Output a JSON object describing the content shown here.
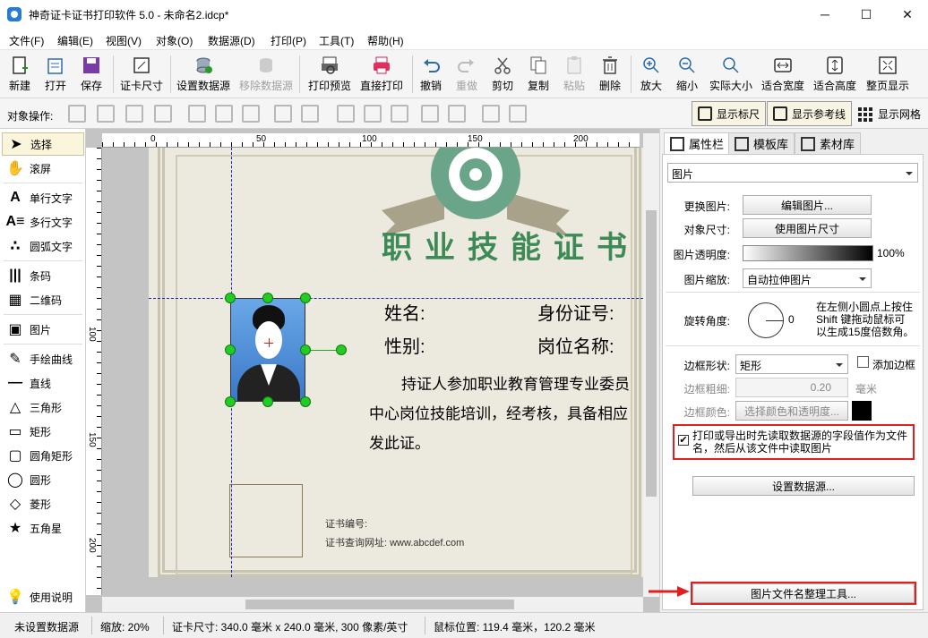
{
  "window": {
    "title": "神奇证卡证书打印软件 5.0 - 未命名2.idcp*"
  },
  "menu": [
    "文件(F)",
    "编辑(E)",
    "视图(V)",
    "对象(O)",
    "数据源(D)",
    "打印(P)",
    "工具(T)",
    "帮助(H)"
  ],
  "toolbar": [
    {
      "label": "新建",
      "icon": "new-file-icon"
    },
    {
      "label": "打开",
      "icon": "open-icon"
    },
    {
      "label": "保存",
      "icon": "save-icon"
    },
    {
      "label": "证卡尺寸",
      "icon": "card-size-icon"
    },
    {
      "label": "设置数据源",
      "icon": "database-icon"
    },
    {
      "label": "移除数据源",
      "icon": "remove-database-icon"
    },
    {
      "label": "打印预览",
      "icon": "print-preview-icon"
    },
    {
      "label": "直接打印",
      "icon": "printer-icon"
    },
    {
      "label": "撤销",
      "icon": "undo-icon"
    },
    {
      "label": "重做",
      "icon": "redo-icon"
    },
    {
      "label": "剪切",
      "icon": "cut-icon"
    },
    {
      "label": "复制",
      "icon": "copy-icon"
    },
    {
      "label": "粘贴",
      "icon": "paste-icon"
    },
    {
      "label": "删除",
      "icon": "delete-icon"
    },
    {
      "label": "放大",
      "icon": "zoom-in-icon"
    },
    {
      "label": "缩小",
      "icon": "zoom-out-icon"
    },
    {
      "label": "实际大小",
      "icon": "actual-size-icon"
    },
    {
      "label": "适合宽度",
      "icon": "fit-width-icon"
    },
    {
      "label": "适合高度",
      "icon": "fit-height-icon"
    },
    {
      "label": "整页显示",
      "icon": "fit-page-icon"
    }
  ],
  "objbar": {
    "label": "对象操作:",
    "show_ruler": "显示标尺",
    "show_guides": "显示参考线",
    "show_grid": "显示网格"
  },
  "tools": [
    "选择",
    "滚屏",
    "单行文字",
    "多行文字",
    "圆弧文字",
    "条码",
    "二维码",
    "图片",
    "手绘曲线",
    "直线",
    "三角形",
    "矩形",
    "圆角矩形",
    "圆形",
    "菱形",
    "五角星",
    "使用说明"
  ],
  "ruler": {
    "h_labels": [
      "0",
      "50",
      "100",
      "150",
      "200"
    ],
    "v_labels": [
      "100",
      "150",
      "200"
    ]
  },
  "certificate": {
    "title": "职业技能证书",
    "name_label": "姓名:",
    "id_label": "身份证号:",
    "gender_label": "性别:",
    "position_label": "岗位名称:",
    "body_line1": "持证人参加职业教育管理专业委员",
    "body_line2": "中心岗位技能培训，经考核，具备相应",
    "body_line3": "发此证。",
    "cert_no": "证书编号:",
    "query_url": "证书查询网址: www.abcdef.com"
  },
  "right_panel": {
    "tabs": [
      "属性栏",
      "模板库",
      "素材库"
    ],
    "object_type": "图片",
    "change_image_label": "更换图片:",
    "edit_image_btn": "编辑图片...",
    "object_size_label": "对象尺寸:",
    "use_image_size_btn": "使用图片尺寸",
    "opacity_label": "图片透明度:",
    "opacity_value": "100%",
    "scale_label": "图片缩放:",
    "scale_value": "自动拉伸图片",
    "rotation_label": "旋转角度:",
    "rotation_value": "0",
    "rotation_hint1": "在左侧小圆点上按住",
    "rotation_hint2": "Shift 键拖动鼠标可",
    "rotation_hint3": "以生成15度倍数角。",
    "border_shape_label": "边框形状:",
    "border_shape_value": "矩形",
    "add_border_label": "添加边框",
    "border_width_label": "边框粗细:",
    "border_width_value": "0.20",
    "border_width_unit": "毫米",
    "border_color_label": "边框颜色:",
    "border_color_btn": "选择颜色和透明度...",
    "datasource_filename_line1": "打印或导出时先读取数据源的字段值作为文件",
    "datasource_filename_line2": "名，然后从该文件中读取图片",
    "set_datasource_btn": "设置数据源...",
    "filename_tool_btn": "图片文件名整理工具..."
  },
  "status": {
    "datasource": "未设置数据源",
    "zoom": "缩放: 20%",
    "card_size": "证卡尺寸: 340.0 毫米 x 240.0 毫米, 300 像素/英寸",
    "mouse_pos": "鼠标位置: 119.4 毫米，120.2 毫米"
  },
  "colors": {
    "accent": "#2a7ad8",
    "cert_green": "#3d8a56",
    "highlight_red": "#e02020",
    "handle_green": "#22cc22"
  }
}
